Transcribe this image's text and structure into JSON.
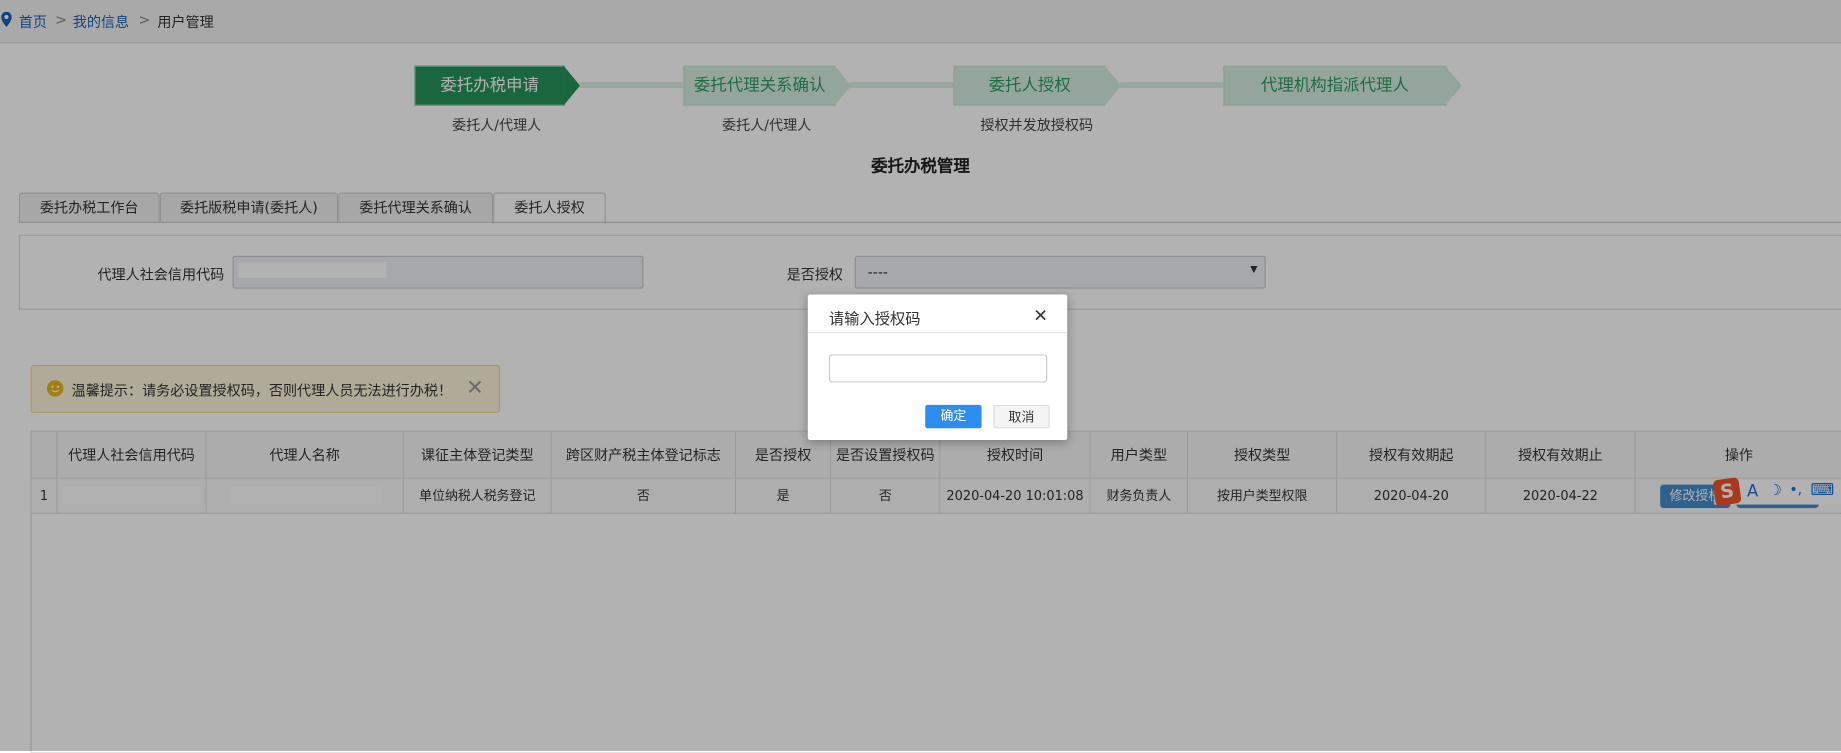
{
  "breadcrumb": {
    "items": [
      "首页",
      "我的信息",
      "用户管理"
    ],
    "separator": ">"
  },
  "steps": [
    {
      "label": "委托办税申请",
      "sub": "委托人/代理人",
      "active": true
    },
    {
      "label": "委托代理关系确认",
      "sub": "委托人/代理人",
      "active": false
    },
    {
      "label": "委托人授权",
      "sub": "授权并发放授权码",
      "active": false
    },
    {
      "label": "代理机构指派代理人",
      "sub": "",
      "active": false
    }
  ],
  "page_title": "委托办税管理",
  "tabs": [
    {
      "label": "委托办税工作台"
    },
    {
      "label": "委托版税申请(委托人)"
    },
    {
      "label": "委托代理关系确认"
    },
    {
      "label": "委托人授权",
      "selected": true
    }
  ],
  "filter": {
    "code_label": "代理人社会信用代码",
    "code_value": "",
    "auth_label": "是否授权",
    "auth_value": "----"
  },
  "tip": {
    "text": "温馨提示：请务必设置授权码，否则代理人员无法进行办税！"
  },
  "table": {
    "headers": [
      "",
      "代理人社会信用代码",
      "代理人名称",
      "课征主体登记类型",
      "跨区财产税主体登记标志",
      "是否授权",
      "是否设置授权码",
      "授权时间",
      "用户类型",
      "授权类型",
      "授权有效期起",
      "授权有效期止",
      "操作"
    ],
    "rows": [
      [
        "1",
        "",
        "",
        "单位纳税人税务登记",
        "否",
        "是",
        "否",
        "2020-04-20 10:01:08",
        "财务负责人",
        "按用户类型权限",
        "2020-04-20",
        "2020-04-22"
      ]
    ],
    "action_label": "修改授权"
  },
  "dialog": {
    "title": "请输入授权码",
    "input_value": "",
    "confirm": "确定",
    "cancel": "取消"
  },
  "ime": {
    "logo": "S",
    "items": [
      "A",
      "☽",
      "•,",
      "⌨"
    ]
  },
  "colors": {
    "accent_green": "#26925a",
    "primary_blue": "#2d8cf0",
    "action_blue": "#428bca"
  }
}
